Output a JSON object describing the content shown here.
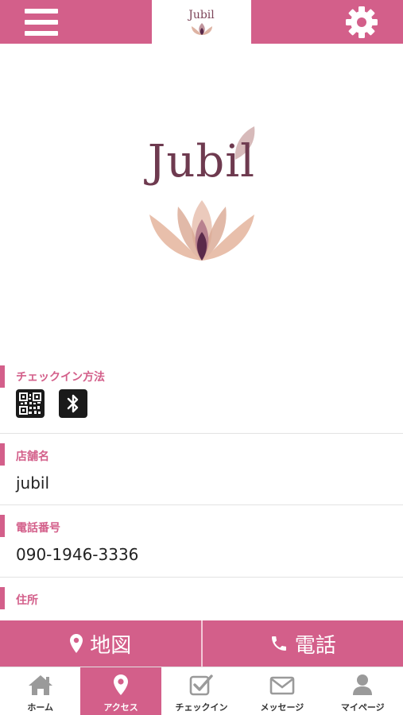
{
  "header": {
    "logo_text": "Jubil",
    "menu_icon": "hamburger-menu-icon",
    "settings_icon": "gear-icon"
  },
  "hero": {
    "brand_text": "Jubil"
  },
  "sections": {
    "checkin": {
      "label": "チェックイン方法",
      "icons": [
        "qr-code-icon",
        "bluetooth-icon"
      ]
    },
    "store_name": {
      "label": "店舗名",
      "value": "jubil"
    },
    "phone": {
      "label": "電話番号",
      "value": "090-1946-3336"
    },
    "address": {
      "label": "住所"
    }
  },
  "actions": {
    "map_label": "地図",
    "call_label": "電話"
  },
  "bottom_nav": {
    "items": [
      {
        "label": "ホーム",
        "icon": "home-icon"
      },
      {
        "label": "アクセス",
        "icon": "map-pin-icon",
        "active": true
      },
      {
        "label": "チェックイン",
        "icon": "checkin-icon"
      },
      {
        "label": "メッセージ",
        "icon": "envelope-icon"
      },
      {
        "label": "マイページ",
        "icon": "user-icon"
      }
    ]
  },
  "colors": {
    "accent": "#d35f8a",
    "logo_text": "#6e3a4f",
    "lotus_dark": "#5a2a4a",
    "lotus_light": "#e2b8a4"
  }
}
